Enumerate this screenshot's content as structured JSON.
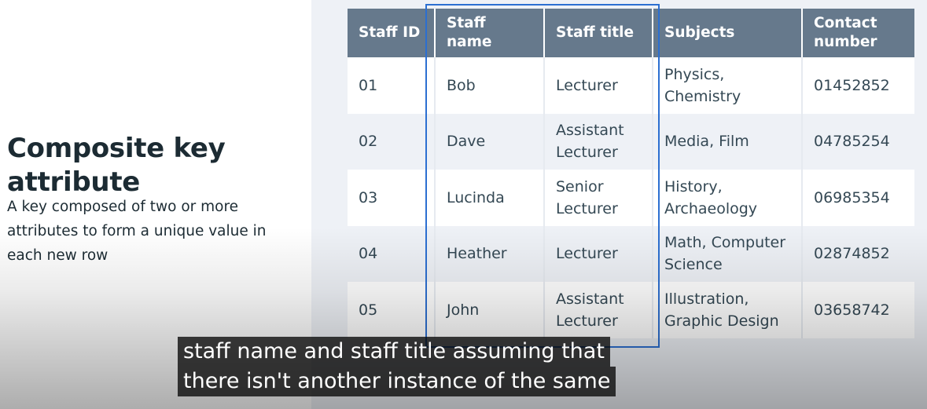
{
  "slide": {
    "heading": "Composite key attribute",
    "description": "A key composed of two or more attributes to form a unique value in each new row"
  },
  "table": {
    "headers": [
      "Staff ID",
      "Staff name",
      "Staff title",
      "Subjects",
      "Contact number"
    ],
    "rows": [
      {
        "id": "01",
        "name": "Bob",
        "title": "Lecturer",
        "subjects": "Physics, Chemistry",
        "contact": "01452852"
      },
      {
        "id": "02",
        "name": "Dave",
        "title": "Assistant Lecturer",
        "subjects": "Media, Film",
        "contact": "04785254"
      },
      {
        "id": "03",
        "name": "Lucinda",
        "title": "Senior Lecturer",
        "subjects": "History, Archaeology",
        "contact": "06985354"
      },
      {
        "id": "04",
        "name": "Heather",
        "title": "Lecturer",
        "subjects": "Math, Computer Science",
        "contact": "02874852"
      },
      {
        "id": "05",
        "name": "John",
        "title": "Assistant Lecturer",
        "subjects": "Illustration, Graphic Design",
        "contact": "03658742"
      }
    ]
  },
  "captions": {
    "line1": "staff name and staff title assuming that",
    "line2": "there isn't another instance of the same"
  },
  "colors": {
    "header_bg": "#66798c",
    "highlight_border": "#2c6fd1",
    "text_dark": "#1c2b33"
  }
}
